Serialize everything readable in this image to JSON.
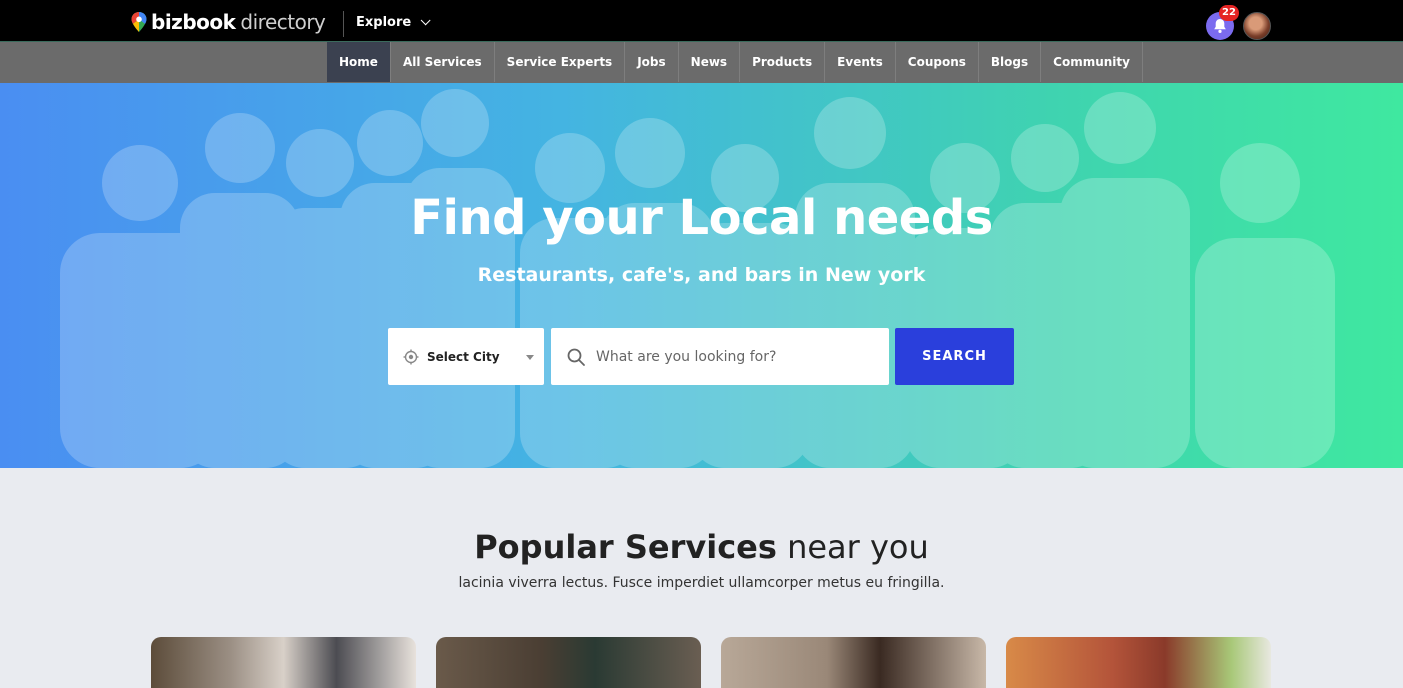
{
  "brand": {
    "name_bold": "bizbook",
    "name_light": "directory"
  },
  "topbar": {
    "explore_label": "Explore",
    "notification_count": "22"
  },
  "nav": {
    "items": [
      {
        "label": "Home",
        "active": true
      },
      {
        "label": "All Services"
      },
      {
        "label": "Service Experts"
      },
      {
        "label": "Jobs"
      },
      {
        "label": "News"
      },
      {
        "label": "Products"
      },
      {
        "label": "Events"
      },
      {
        "label": "Coupons"
      },
      {
        "label": "Blogs"
      },
      {
        "label": "Community"
      }
    ]
  },
  "hero": {
    "title": "Find your Local needs",
    "subtitle": "Restaurants, cafe's, and bars in New york",
    "city_select": "Select City",
    "search_placeholder": "What are you looking for?",
    "search_button": "SEARCH"
  },
  "popular": {
    "title_bold": "Popular Services",
    "title_light": "near you",
    "subtitle": "lacinia viverra lectus. Fusce imperdiet ullamcorper metus eu fringilla."
  },
  "colors": {
    "accent": "#2a3fdc",
    "nav_active": "#3b4150",
    "badge": "#e52424",
    "bell": "#7b6bef"
  }
}
